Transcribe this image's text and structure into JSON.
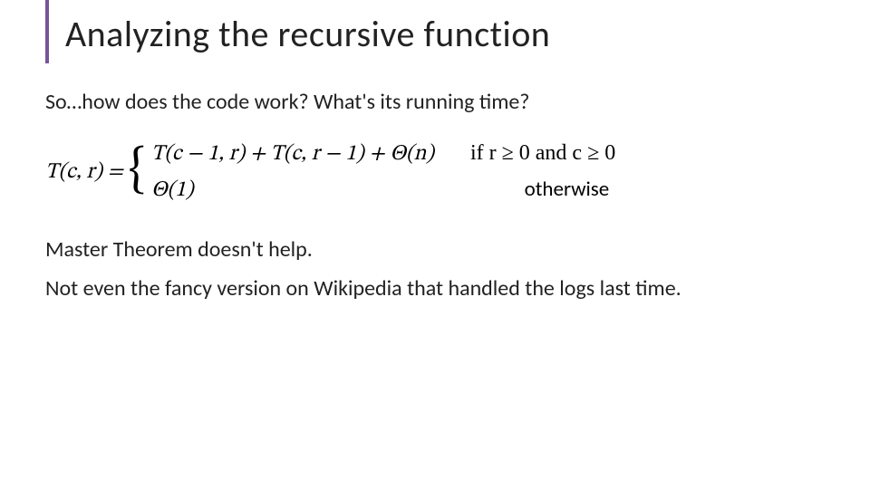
{
  "slide": {
    "title": "Analyzing the recursive function",
    "intro": "So…how does the code work? What's its running time?",
    "recurrence": {
      "lhs": "T(c, r) =",
      "case1_expr": "T(c − 1, r) + T(c, r − 1) + Θ(n)",
      "case1_cond": "if r ≥ 0 and c ≥ 0",
      "case2_expr": "Θ(1)",
      "case2_cond": "otherwise"
    },
    "conclusion1": "Master Theorem doesn't help.",
    "conclusion2": "Not even the fancy version on Wikipedia that handled the logs last time."
  }
}
